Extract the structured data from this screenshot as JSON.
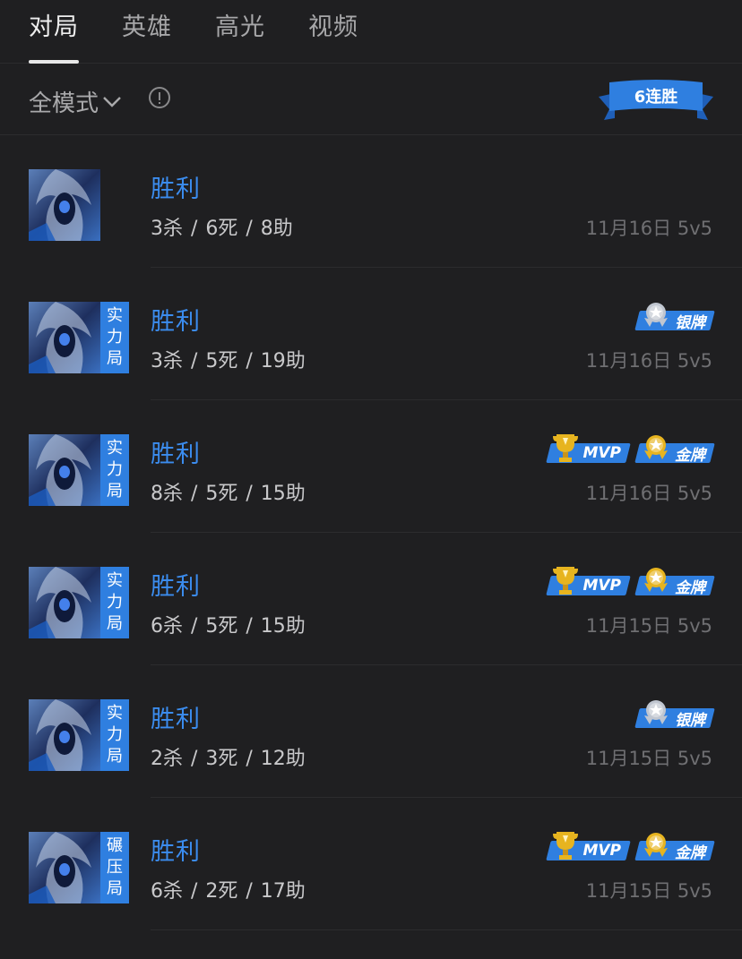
{
  "tabs": [
    {
      "label": "对局",
      "active": true
    },
    {
      "label": "英雄",
      "active": false
    },
    {
      "label": "高光",
      "active": false
    },
    {
      "label": "视频",
      "active": false
    }
  ],
  "filter": {
    "mode_label": "全模式",
    "info_icon": "info-circle-icon",
    "streak_label": "6连胜"
  },
  "colors": {
    "accent": "#2f7fe0",
    "win_text": "#3b8cee",
    "background": "#1f1f21",
    "gold": "#e7b41f",
    "silver": "#c0c6d0"
  },
  "matches": [
    {
      "result": "胜利",
      "kda": "3杀 / 6死 / 8助",
      "meta": "11月16日 5v5",
      "mode_tag": "",
      "badges": []
    },
    {
      "result": "胜利",
      "kda": "3杀 / 5死 / 19助",
      "meta": "11月16日 5v5",
      "mode_tag": "实力局",
      "badges": [
        {
          "type": "silver",
          "label": "银牌"
        }
      ]
    },
    {
      "result": "胜利",
      "kda": "8杀 / 5死 / 15助",
      "meta": "11月16日 5v5",
      "mode_tag": "实力局",
      "badges": [
        {
          "type": "mvp",
          "label": "MVP"
        },
        {
          "type": "gold",
          "label": "金牌"
        }
      ]
    },
    {
      "result": "胜利",
      "kda": "6杀 / 5死 / 15助",
      "meta": "11月15日 5v5",
      "mode_tag": "实力局",
      "badges": [
        {
          "type": "mvp",
          "label": "MVP"
        },
        {
          "type": "gold",
          "label": "金牌"
        }
      ]
    },
    {
      "result": "胜利",
      "kda": "2杀 / 3死 / 12助",
      "meta": "11月15日 5v5",
      "mode_tag": "实力局",
      "badges": [
        {
          "type": "silver",
          "label": "银牌"
        }
      ]
    },
    {
      "result": "胜利",
      "kda": "6杀 / 2死 / 17助",
      "meta": "11月15日 5v5",
      "mode_tag": "碾压局",
      "badges": [
        {
          "type": "mvp",
          "label": "MVP"
        },
        {
          "type": "gold",
          "label": "金牌"
        }
      ]
    }
  ]
}
